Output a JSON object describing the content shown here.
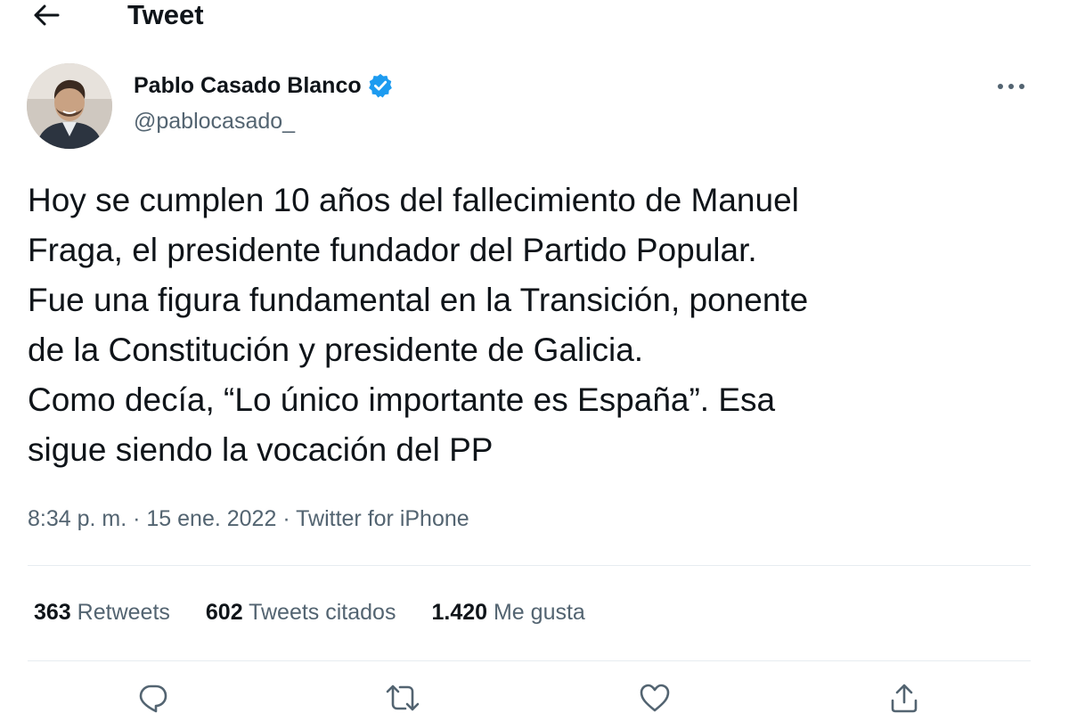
{
  "header": {
    "title": "Tweet"
  },
  "author": {
    "display_name": "Pablo Casado Blanco",
    "handle": "@pablocasado_"
  },
  "tweet": {
    "lines": [
      "Hoy se cumplen 10 años del fallecimiento de Manuel",
      "Fraga, el presidente fundador del Partido Popular.",
      "Fue una figura fundamental en la Transición, ponente",
      "de la Constitución y presidente de Galicia.",
      "Como decía, “Lo único importante es España”. Esa",
      "sigue siendo la vocación del PP"
    ]
  },
  "meta": {
    "time": "8:34 p. m.",
    "separator": " · ",
    "date": "15 ene. 2022",
    "source": "Twitter for iPhone"
  },
  "stats": {
    "retweets_count": "363",
    "retweets_label": "Retweets",
    "quotes_count": "602",
    "quotes_label": "Tweets citados",
    "likes_count": "1.420",
    "likes_label": "Me gusta"
  },
  "colors": {
    "verified": "#1d9bf0",
    "secondary_text": "#536471",
    "primary_text": "#0f1419",
    "divider": "#e6ecf0"
  },
  "icons": {
    "back": "arrow-left-icon",
    "verified": "verified-badge-icon",
    "more": "more-dots-icon",
    "reply": "reply-icon",
    "retweet": "retweet-icon",
    "like": "heart-icon",
    "share": "share-icon"
  }
}
